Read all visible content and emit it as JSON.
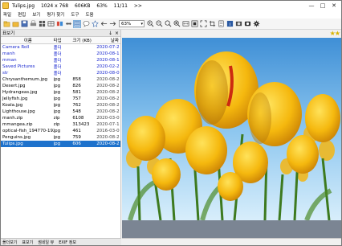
{
  "window": {
    "file_name": "Tulips.jpg",
    "dimensions": "1024 x 768",
    "file_size": "606KB",
    "zoom": "63%",
    "counter": "11/11",
    "nav": ">>"
  },
  "menu": [
    "파일",
    "편집",
    "보기",
    "평가 찾기",
    "도구",
    "도움"
  ],
  "toolbar": {
    "zoom_value": "63%"
  },
  "left_panel": {
    "title": "표보기",
    "pin": "↓",
    "close": "×",
    "columns": {
      "name": "이름",
      "type": "타입",
      "size": "크기 (KB)",
      "date": "날짜"
    },
    "rows": [
      {
        "name": "Camera Roll",
        "type": "폴더",
        "size": "",
        "date": "2020-07-2",
        "kind": "folder"
      },
      {
        "name": "manh",
        "type": "폴더",
        "size": "",
        "date": "2020-08-1",
        "kind": "folder"
      },
      {
        "name": "mman",
        "type": "폴더",
        "size": "",
        "date": "2020-08-1",
        "kind": "folder"
      },
      {
        "name": "Saved Pictures",
        "type": "폴더",
        "size": "",
        "date": "2020-02-2",
        "kind": "folder"
      },
      {
        "name": "str",
        "type": "폴더",
        "size": "",
        "date": "2020-08-0",
        "kind": "folder"
      },
      {
        "name": "Chrysanthemum.jpg",
        "type": "jpg",
        "size": "858",
        "date": "2020-08-2",
        "kind": "file"
      },
      {
        "name": "Desert.jpg",
        "type": "jpg",
        "size": "826",
        "date": "2020-08-2",
        "kind": "file"
      },
      {
        "name": "Hydrangeas.jpg",
        "type": "jpg",
        "size": "581",
        "date": "2020-08-2",
        "kind": "file"
      },
      {
        "name": "Jellyfish.jpg",
        "type": "jpg",
        "size": "757",
        "date": "2020-08-2",
        "kind": "file"
      },
      {
        "name": "Koala.jpg",
        "type": "jpg",
        "size": "762",
        "date": "2020-08-2",
        "kind": "file"
      },
      {
        "name": "Lighthouse.jpg",
        "type": "jpg",
        "size": "548",
        "date": "2020-08-2",
        "kind": "file"
      },
      {
        "name": "manh.zip",
        "type": "zip",
        "size": "6108",
        "date": "2020-03-0",
        "kind": "file"
      },
      {
        "name": "mmangea.zip",
        "type": "zip",
        "size": "313423",
        "date": "2020-07-1",
        "kind": "file"
      },
      {
        "name": "optical-fish_194770-192..",
        "type": "jpg",
        "size": "461",
        "date": "2016-03-0",
        "kind": "file"
      },
      {
        "name": "Penguins.jpg",
        "type": "jpg",
        "size": "759",
        "date": "2020-08-2",
        "kind": "file"
      },
      {
        "name": "Tulips.jpg",
        "type": "jpg",
        "size": "606",
        "date": "2020-08-2",
        "kind": "selected"
      }
    ]
  },
  "bottom_tabs": [
    "폴더보기",
    "표보기",
    "썸네일 뷰",
    "EXIF 정보"
  ],
  "viewer": {
    "rating": "★★"
  },
  "colors": {
    "folder_text": "#1d2bd0",
    "selection": "#1e72cc",
    "viewer_bg": "#7b8593"
  }
}
